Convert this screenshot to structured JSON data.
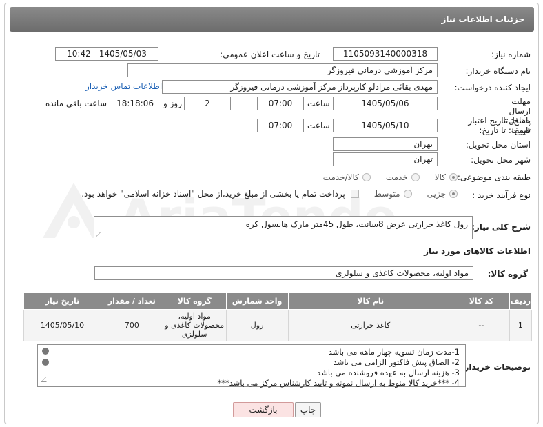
{
  "header": {
    "title": "جزئیات اطلاعات نیاز"
  },
  "fields": {
    "need_number_label": "شماره نیاز:",
    "need_number": "1105093140000318",
    "announce_label": "تاریخ و ساعت اعلان عمومی:",
    "announce_value": "1405/05/03 - 10:42",
    "buyer_org_label": "نام دستگاه خریدار:",
    "buyer_org": "مرکز آموزشی درمانی فیروزگر",
    "requester_label": "ایجاد کننده درخواست:",
    "requester": "مهدی بقائی مرادلو کارپرداز مرکز آموزشی درمانی فیروزگر",
    "contact_link": "اطلاعات تماس خریدار",
    "reply_deadline_label": "مهلت ارسال پاسخ: تا تاریخ:",
    "reply_date": "1405/05/06",
    "time_label": "ساعت",
    "reply_time": "07:00",
    "days_value": "2",
    "days_label": "روز و",
    "remaining_time": "18:18:06",
    "remaining_label": "ساعت باقی مانده",
    "price_validity_label": "حداقل تاریخ اعتبار قیمت: تا تاریخ:",
    "price_validity_date": "1405/05/10",
    "price_validity_time": "07:00",
    "delivery_province_label": "استان محل تحویل:",
    "delivery_province": "تهران",
    "delivery_city_label": "شهر محل تحویل:",
    "delivery_city": "تهران",
    "category_label": "طبقه بندی موضوعی:",
    "category_options": [
      "کالا",
      "خدمت",
      "کالا/خدمت"
    ],
    "process_label": "نوع فرآیند خرید :",
    "process_options": [
      "جزیی",
      "متوسط"
    ],
    "payment_note": "پرداخت تمام یا بخشی از مبلغ خرید،از محل \"اسناد خزانه اسلامی\" خواهد بود."
  },
  "description": {
    "label": "شرح کلی نیاز:",
    "value": "رول کاغذ حرارتی عرض 8سانت، طول 45متر مارک هانسول کره"
  },
  "goods": {
    "section_title": "اطلاعات کالاهای مورد نیاز",
    "group_label": "گروه کالا:",
    "group_value": "مواد اولیه، محصولات کاغذی و سلولزی",
    "columns": [
      "ردیف",
      "کد کالا",
      "نام کالا",
      "واحد شمارش",
      "گروه کالا",
      "تعداد / مقدار",
      "تاریخ نیاز"
    ],
    "rows": [
      {
        "row": "1",
        "code": "--",
        "name": "کاغذ حرارتی",
        "unit": "رول",
        "group": "مواد اولیه، محصولات کاغذی و سلولزی",
        "qty": "700",
        "date": "1405/05/10"
      }
    ]
  },
  "buyer_notes": {
    "label": "توضیحات خریدار:",
    "lines": [
      "1-مدت زمان تسویه چهار ماهه می باشد",
      "2- الصاق پیش فاکتور الزامی می باشد",
      "3- هزینه ارسال به عهده فروشنده می باشد",
      "4- ***خرید کالا منوط به ارسال نمونه و تایید کارشناس مرکز می باشد***"
    ]
  },
  "buttons": {
    "print": "چاپ",
    "back": "بازگشت"
  },
  "watermark": "AriaTender.net"
}
